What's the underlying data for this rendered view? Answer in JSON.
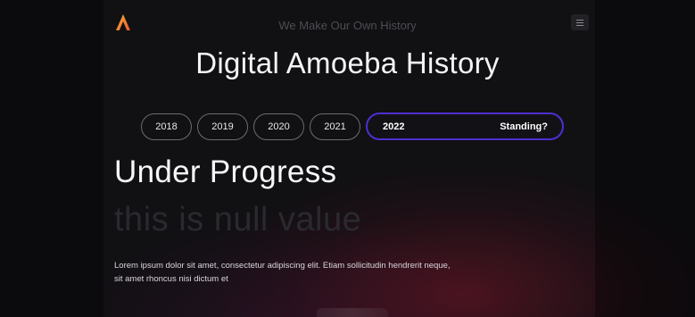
{
  "header": {
    "logo_icon": "amoeba-logo-icon",
    "tagline": "We Make Our Own History",
    "menu_icon": "hamburger-menu-icon"
  },
  "page_title": "Digital Amoeba History",
  "years": {
    "items": [
      "2018",
      "2019",
      "2020",
      "2021"
    ],
    "active": {
      "label": "2022",
      "status": "Standing?"
    }
  },
  "content": {
    "heading": "Under Progress",
    "subheading": "this is null value",
    "description": "Lorem ipsum dolor sit amet, consectetur adipiscing elit. Etiam sollicitudin hendrerit neque, sit amet rhoncus nisi dictum et"
  },
  "colors": {
    "accent": "#4e2fd1",
    "background": "#111013",
    "logo_orange": "#f2892b"
  }
}
